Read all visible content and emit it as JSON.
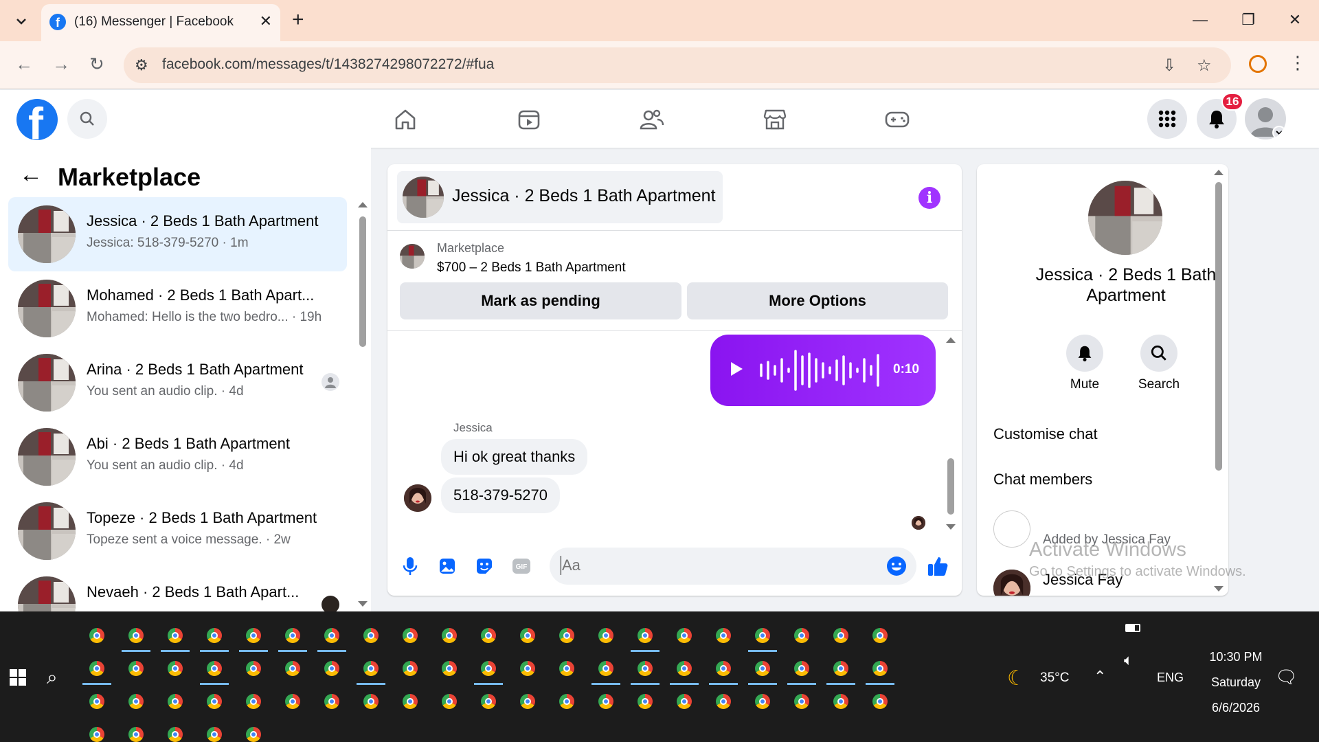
{
  "browser": {
    "tab_title": "(16) Messenger | Facebook",
    "url": "facebook.com/messages/t/1438274298072272/#fua",
    "colors": {
      "chrome_bg": "#fbdfcf",
      "toolbar_bg": "#fdf3ee"
    }
  },
  "header": {
    "notification_count": "16",
    "nav_icons": [
      "home-icon",
      "video-icon",
      "friends-icon",
      "marketplace-icon",
      "gaming-icon"
    ],
    "colors": {
      "brand": "#1877f2",
      "badge": "#e41e3f"
    }
  },
  "sidebar": {
    "title": "Marketplace",
    "conversations": [
      {
        "name": "Jessica · 2 Beds 1 Bath Apartment",
        "preview": "Jessica: 518-379-5270 · 1m",
        "active": true
      },
      {
        "name": "Mohamed · 2 Beds 1 Bath Apart...",
        "preview": "Mohamed: Hello is the two bedro... · 19h"
      },
      {
        "name": "Arina · 2 Beds 1 Bath Apartment",
        "preview": "You sent an audio clip. · 4d"
      },
      {
        "name": "Abi · 2 Beds 1 Bath Apartment",
        "preview": "You sent an audio clip. · 4d"
      },
      {
        "name": "Topeze · 2 Beds 1 Bath Apartment",
        "preview": "Topeze sent a voice message. · 2w"
      },
      {
        "name": "Nevaeh · 2 Beds 1 Bath Apart...",
        "preview": ""
      }
    ]
  },
  "chat": {
    "title": "Jessica · 2 Beds 1 Bath Apartment",
    "marketplace_label": "Marketplace",
    "listing": "$700 – 2 Beds 1 Bath Apartment",
    "mark_pending_label": "Mark as pending",
    "more_options_label": "More Options",
    "audio_duration": "0:10",
    "sender_name": "Jessica",
    "messages": [
      "Hi ok great thanks",
      "518-379-5270"
    ],
    "composer_placeholder": "Aa",
    "accent": "#a033ff"
  },
  "info_panel": {
    "name": "Jessica · 2 Beds 1 Bath Apartment",
    "mute_label": "Mute",
    "search_label": "Search",
    "customise_label": "Customise chat",
    "members_label": "Chat members",
    "member_note": "Added by Jessica Fay",
    "member_name": "Jessica Fay"
  },
  "watermark": {
    "line1": "Activate Windows",
    "line2": "Go to Settings to activate Windows."
  },
  "taskbar": {
    "weather": "35°C",
    "language": "ENG",
    "time": "10:30 PM",
    "day": "Saturday",
    "date": "6/6/2026"
  }
}
